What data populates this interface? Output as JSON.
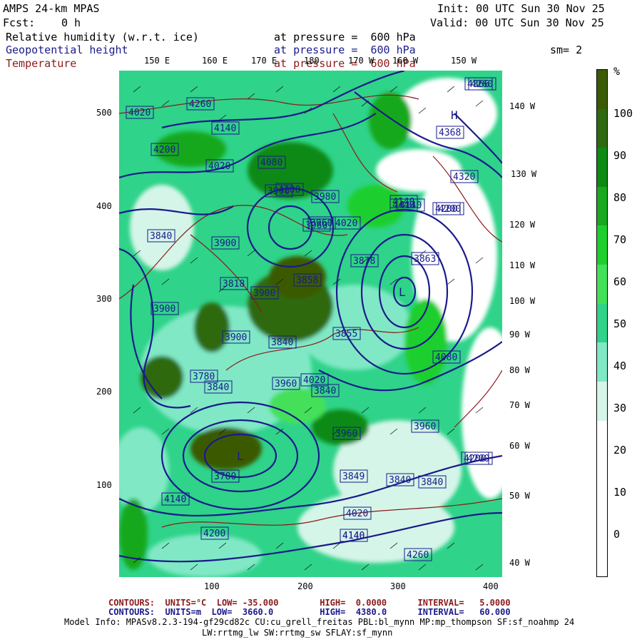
{
  "header": {
    "model": "AMPS 24-km MPAS",
    "fcst_label": "Fcst:",
    "fcst_value": "0 h",
    "init": "Init: 00 UTC Sun 30 Nov 25",
    "valid": "Valid: 00 UTC Sun 30 Nov 25",
    "var1": "Relative humidity (w.r.t. ice)",
    "var2": "Geopotential height",
    "var3": "Temperature",
    "pressure1": "at pressure =  600 hPa",
    "pressure2": "at pressure =  600 hPa",
    "pressure3": "at pressure =  600 hPa",
    "smoothing": "sm= 2"
  },
  "colors": {
    "navy": "#1a1a8c",
    "maroon": "#8b1a1a",
    "rh_scale": [
      "#ffffff",
      "#ffffff",
      "#ffffff",
      "#ffffff",
      "#d5f5e8",
      "#80e8c5",
      "#2fd389",
      "#45e05a",
      "#1fcf2d",
      "#19a81f",
      "#0d8a13",
      "#2f6a10",
      "#3b5a06"
    ]
  },
  "colorbar": {
    "unit": "%",
    "labels": [
      "100",
      "90",
      "80",
      "70",
      "60",
      "50",
      "40",
      "30",
      "20",
      "10",
      "0"
    ]
  },
  "left_axis": [
    "500",
    "400",
    "300",
    "200",
    "100"
  ],
  "bottom_axis": [
    "100",
    "200",
    "300",
    "400"
  ],
  "top_lon": [
    "150 E",
    "160 E",
    "170 E",
    "180",
    "170 W",
    "160 W",
    "150 W"
  ],
  "right_lon": [
    "140 W",
    "130 W",
    "120 W",
    "110 W",
    "100 W",
    "90 W",
    "80 W",
    "70 W",
    "60 W",
    "50 W",
    "40 W"
  ],
  "contour_labels": [
    "4260",
    "4020",
    "4140",
    "4200",
    "4020",
    "4080",
    "4200",
    "3980",
    "4140",
    "3960",
    "3900",
    "3878",
    "3840",
    "3900",
    "3818",
    "3900",
    "3858",
    "3900",
    "3855",
    "3780",
    "3840",
    "3900",
    "3840",
    "3960",
    "3960",
    "4020",
    "3840",
    "3863",
    "3780",
    "3849",
    "3840",
    "3840",
    "4140",
    "4200",
    "4020",
    "4200",
    "4140",
    "4260",
    "4260",
    "4320",
    "4200",
    "4080",
    "3960",
    "4140",
    "4366",
    "4368",
    "4440",
    "4200",
    "4020",
    "3960",
    "4200",
    "4140"
  ],
  "pressure_centers": [
    "H",
    "L",
    "L"
  ],
  "footer": {
    "line1_label": "CONTOURS:",
    "line1_units": "UNITS=°C",
    "line1_low": "LOW= -35.000",
    "line1_high": "HIGH=  0.0000",
    "line1_interval": "INTERVAL=   5.0000",
    "line2_label": "CONTOURS:",
    "line2_units": "UNITS=m",
    "line2_low": "LOW=  3660.0",
    "line2_high": "HIGH=  4380.0",
    "line2_interval": "INTERVAL=   60.000",
    "model_info": "Model Info: MPASv8.2.3-194-gf29cd82c CU:cu_grell_freitas PBL:bl_mynn MP:mp_thompson SF:sf_noahmp 24",
    "model_info2": "LW:rrtmg_lw SW:rrtmg_sw SFLAY:sf_mynn"
  }
}
